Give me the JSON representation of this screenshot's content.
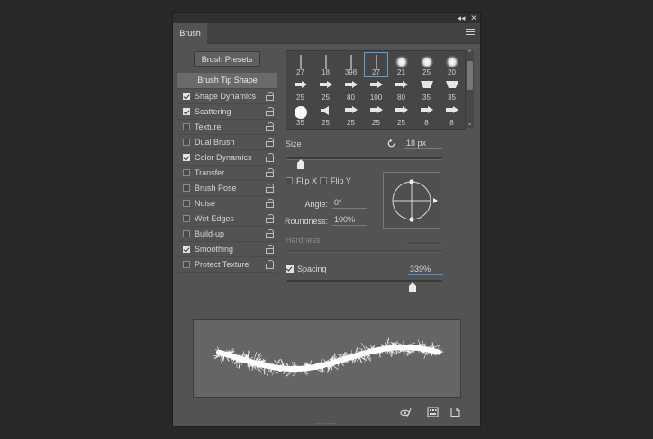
{
  "panel": {
    "title": "Brush",
    "topbar": {
      "collapse_glyph": "◂◂",
      "close_glyph": "✕"
    },
    "presets_button": "Brush Presets"
  },
  "options": {
    "header": "Brush Tip Shape",
    "items": [
      {
        "label": "Shape Dynamics",
        "checked": true
      },
      {
        "label": "Scattering",
        "checked": true
      },
      {
        "label": "Texture",
        "checked": false
      },
      {
        "label": "Dual Brush",
        "checked": false
      },
      {
        "label": "Color Dynamics",
        "checked": true
      },
      {
        "label": "Transfer",
        "checked": false
      },
      {
        "label": "Brush Pose",
        "checked": false
      },
      {
        "label": "Noise",
        "checked": false
      },
      {
        "label": "Wet Edges",
        "checked": false
      },
      {
        "label": "Build-up",
        "checked": false
      },
      {
        "label": "Smoothing",
        "checked": true
      },
      {
        "label": "Protect Texture",
        "checked": false
      }
    ]
  },
  "tips": {
    "rows": [
      [
        {
          "size": "27",
          "kind": "line"
        },
        {
          "size": "18",
          "kind": "line"
        },
        {
          "size": "398",
          "kind": "line"
        },
        {
          "size": "27",
          "kind": "line",
          "selected": true
        },
        {
          "size": "21",
          "kind": "soft"
        },
        {
          "size": "25",
          "kind": "soft"
        },
        {
          "size": "20",
          "kind": "soft"
        }
      ],
      [
        {
          "size": "25",
          "kind": "arrow"
        },
        {
          "size": "25",
          "kind": "arrow"
        },
        {
          "size": "80",
          "kind": "arrow"
        },
        {
          "size": "100",
          "kind": "arrow"
        },
        {
          "size": "80",
          "kind": "arrow"
        },
        {
          "size": "35",
          "kind": "block"
        },
        {
          "size": "35",
          "kind": "block"
        }
      ],
      [
        {
          "size": "35",
          "kind": "hard"
        },
        {
          "size": "25",
          "kind": "speaker"
        },
        {
          "size": "25",
          "kind": "arrow"
        },
        {
          "size": "25",
          "kind": "arrow"
        },
        {
          "size": "25",
          "kind": "arrow"
        },
        {
          "size": "8",
          "kind": "arrow"
        },
        {
          "size": "8",
          "kind": "arrow"
        }
      ]
    ]
  },
  "controls": {
    "size_label": "Size",
    "size_value": "18 px",
    "size_slider": 0.09,
    "flip_x": "Flip X",
    "flip_y": "Flip Y",
    "angle_label": "Angle:",
    "angle_value": "0°",
    "roundness_label": "Roundness:",
    "roundness_value": "100%",
    "hardness_label": "Hardness",
    "spacing_label": "Spacing",
    "spacing_value": "339%",
    "spacing_slider": 0.81
  },
  "colors": {
    "panel": "#535353",
    "accent": "#4a8ed6",
    "stroke": "#ffffff"
  }
}
